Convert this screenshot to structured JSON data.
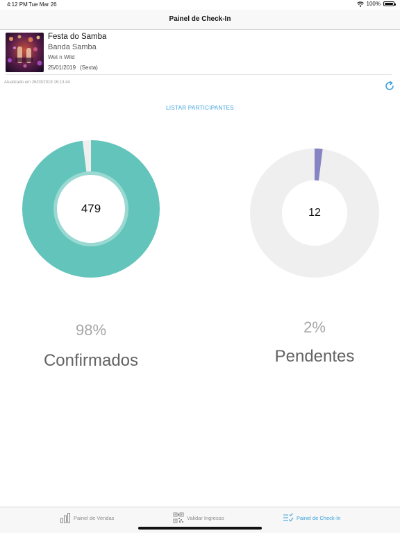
{
  "status_bar": {
    "time": "4:12 PM",
    "date": "Tue Mar 26",
    "battery": "100%"
  },
  "nav": {
    "title": "Painel de Check-In"
  },
  "event": {
    "name": "Festa do Samba",
    "artist": "Banda Samba",
    "venue": "Wet n Wild",
    "date": "25/01/2019",
    "weekday": "(Sexta)"
  },
  "updated_text": "Atualizado em 26/03/2019 16:13:44",
  "list_link": "LISTAR PARTICIPANTES",
  "stats": {
    "confirmed": {
      "count": "479",
      "percent": "98%",
      "label": "Confirmados",
      "fraction": 0.98,
      "color": "#62c4bb"
    },
    "pending": {
      "count": "12",
      "percent": "2%",
      "label": "Pendentes",
      "fraction": 0.02,
      "color": "#8784c4"
    }
  },
  "colors": {
    "accent": "#3a9fdc",
    "donut_track": "#efefef",
    "confirmed_inner_ring": "#9ad9d2"
  },
  "tabs": [
    {
      "label": "Painel de Vendas",
      "icon": "bar-chart-icon",
      "active": false
    },
    {
      "label": "Validar Ingresso",
      "icon": "qr-code-icon",
      "active": false
    },
    {
      "label": "Painel de Check-In",
      "icon": "checklist-icon",
      "active": true
    }
  ]
}
